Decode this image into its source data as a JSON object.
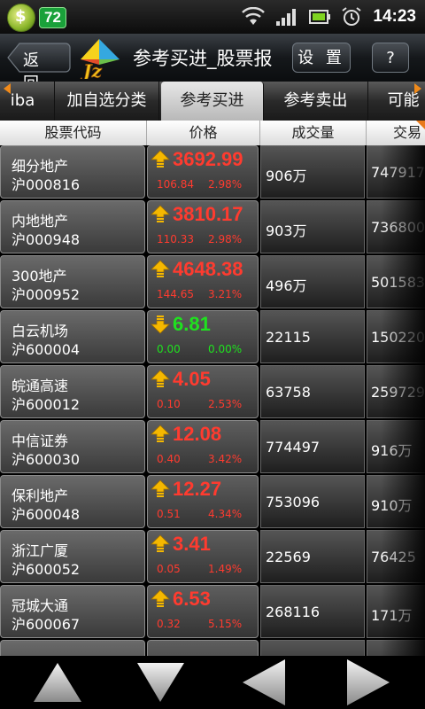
{
  "status_bar": {
    "badge": "72",
    "time": "14:23"
  },
  "title_bar": {
    "back_label": "返 回",
    "title": "参考买进_股票报",
    "settings_label": "设 置",
    "help_label": "?"
  },
  "tabs": [
    {
      "label": "iba",
      "active": false
    },
    {
      "label": "加自选分类",
      "active": false
    },
    {
      "label": "参考买进",
      "active": true
    },
    {
      "label": "参考卖出",
      "active": false
    },
    {
      "label": "可能",
      "active": false
    }
  ],
  "columns": [
    "股票代码",
    "价格",
    "成交量",
    "交易"
  ],
  "rows": [
    {
      "name": "细分地产",
      "code": "沪000816",
      "price": "3692.99",
      "change": "106.84",
      "change_pct": "2.98%",
      "volume": "906万",
      "amount": "747917",
      "trend": "up"
    },
    {
      "name": "内地地产",
      "code": "沪000948",
      "price": "3810.17",
      "change": "110.33",
      "change_pct": "2.98%",
      "volume": "903万",
      "amount": "736800",
      "trend": "up"
    },
    {
      "name": "300地产",
      "code": "沪000952",
      "price": "4648.38",
      "change": "144.65",
      "change_pct": "3.21%",
      "volume": "496万",
      "amount": "501583",
      "trend": "up"
    },
    {
      "name": "白云机场",
      "code": "沪600004",
      "price": "6.81",
      "change": "0.00",
      "change_pct": "0.00%",
      "volume": "22115",
      "amount": "150220",
      "trend": "flat"
    },
    {
      "name": "皖通高速",
      "code": "沪600012",
      "price": "4.05",
      "change": "0.10",
      "change_pct": "2.53%",
      "volume": "63758",
      "amount": "259729",
      "trend": "up"
    },
    {
      "name": "中信证券",
      "code": "沪600030",
      "price": "12.08",
      "change": "0.40",
      "change_pct": "3.42%",
      "volume": "774497",
      "amount": "916万",
      "trend": "up"
    },
    {
      "name": "保利地产",
      "code": "沪600048",
      "price": "12.27",
      "change": "0.51",
      "change_pct": "4.34%",
      "volume": "753096",
      "amount": "910万",
      "trend": "up"
    },
    {
      "name": "浙江广厦",
      "code": "沪600052",
      "price": "3.41",
      "change": "0.05",
      "change_pct": "1.49%",
      "volume": "22569",
      "amount": "76425",
      "trend": "up"
    },
    {
      "name": "冠城大通",
      "code": "沪600067",
      "price": "6.53",
      "change": "0.32",
      "change_pct": "5.15%",
      "volume": "268116",
      "amount": "171万",
      "trend": "up"
    }
  ],
  "colors": {
    "up": "#ff3b2f",
    "flat": "#1fe21f",
    "arrow_up": "#f5b800"
  },
  "nav": [
    "scroll-up-icon",
    "scroll-down-icon",
    "page-left-icon",
    "page-right-icon"
  ]
}
